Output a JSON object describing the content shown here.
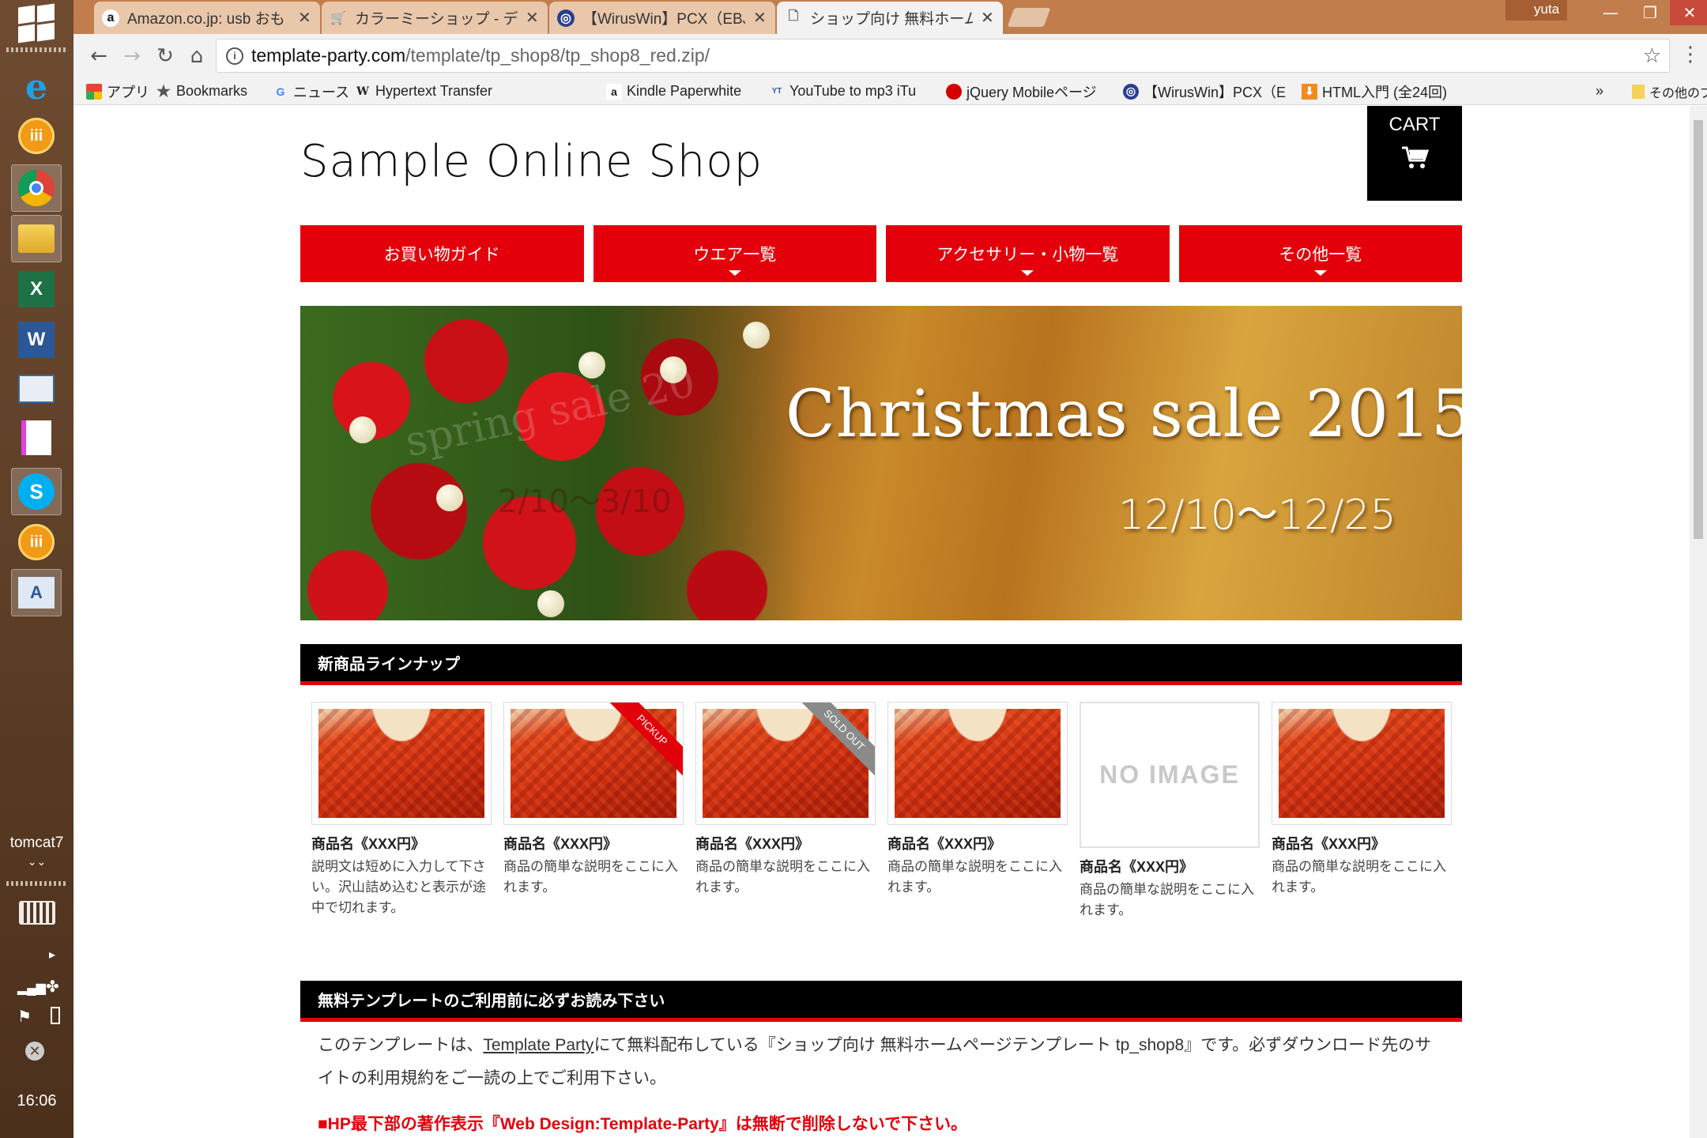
{
  "taskbar": {
    "label": "tomcat7",
    "clock": "16:06",
    "apps": [
      "windows-start",
      "internet-explorer",
      "app-iii",
      "chrome",
      "file-explorer",
      "excel",
      "word",
      "app-window",
      "notepad",
      "skype",
      "app-iii-2",
      "text-editor"
    ]
  },
  "browser": {
    "tabs": [
      {
        "title": "Amazon.co.jp: usb おも",
        "icon": "amazon-icon"
      },
      {
        "title": "カラーミーショップ - デザイン",
        "icon": "cart-icon"
      },
      {
        "title": "【WirusWin】PCX（EBJ-",
        "icon": "globe-icon"
      },
      {
        "title": "ショップ向け 無料ホームペー",
        "icon": "page-icon"
      }
    ],
    "user": "yuta",
    "url_host": "template-party.com",
    "url_path": "/template/tp_shop8/tp_shop8_red.zip/",
    "bookmarks": [
      {
        "label": "アプリ",
        "icon": "apps-icon"
      },
      {
        "label": "Bookmarks",
        "icon": "star-icon"
      },
      {
        "label": "ニュース",
        "icon": "google-icon"
      },
      {
        "label": "Hypertext Transfer",
        "icon": "wikipedia-icon"
      },
      {
        "label": "Kindle Paperwhite",
        "icon": "amazon-icon"
      },
      {
        "label": "YouTube to mp3 iTu",
        "icon": "yt-mp3-icon"
      },
      {
        "label": "jQuery Mobileページ",
        "icon": "red-circle-icon"
      },
      {
        "label": "【WirusWin】PCX（EI",
        "icon": "globe-icon"
      },
      {
        "label": "HTML入門 (全24回)",
        "icon": "download-icon"
      }
    ],
    "overflow": "»",
    "other_bookmarks": "その他のブックマーク"
  },
  "site": {
    "logo": "Sample Online Shop",
    "cart_label": "CART",
    "nav": [
      {
        "label": "お買い物ガイド",
        "dropdown": false
      },
      {
        "label": "ウエア一覧",
        "dropdown": true
      },
      {
        "label": "アクセサリー・小物一覧",
        "dropdown": true
      },
      {
        "label": "その他一覧",
        "dropdown": true
      }
    ],
    "banner": {
      "title": "Christmas sale 2015",
      "dates": "12/10〜12/25",
      "ghost_text": "spring sale 20",
      "ghost_dates": "2/10〜3/10"
    },
    "new_products_heading": "新商品ラインナップ",
    "products": [
      {
        "name": "商品名《XXX円》",
        "desc": "説明文は短めに入力して下さい。沢山詰め込むと表示が途中で切れます。",
        "image": "sweater",
        "ribbon": ""
      },
      {
        "name": "商品名《XXX円》",
        "desc": "商品の簡単な説明をここに入れます。",
        "image": "sweater",
        "ribbon": "PICKUP"
      },
      {
        "name": "商品名《XXX円》",
        "desc": "商品の簡単な説明をここに入れます。",
        "image": "sweater",
        "ribbon": "SOLD OUT"
      },
      {
        "name": "商品名《XXX円》",
        "desc": "商品の簡単な説明をここに入れます。",
        "image": "sweater",
        "ribbon": ""
      },
      {
        "name": "商品名《XXX円》",
        "desc": "商品の簡単な説明をここに入れます。",
        "image": "none",
        "ribbon": "",
        "noimage_text": "NO IMAGE"
      },
      {
        "name": "商品名《XXX円》",
        "desc": "商品の簡単な説明をここに入れます。",
        "image": "sweater",
        "ribbon": ""
      }
    ],
    "notice_heading": "無料テンプレートのご利用前に必ずお読み下さい",
    "notice_before": "このテンプレートは、",
    "notice_link": "Template Party",
    "notice_after": "にて無料配布している『ショップ向け 無料ホームページテンプレート tp_shop8』です。必ずダウンロード先のサイトの利用規約をご一読の上でご利用下さい。",
    "warning": "■HP最下部の著作表示『Web Design:Template-Party』は無断で削除しないで下さい。"
  },
  "colors": {
    "accent": "#e3000b",
    "header_black": "#000000",
    "tabstrip": "#c17d4c",
    "taskbar": "#5e3f27"
  }
}
